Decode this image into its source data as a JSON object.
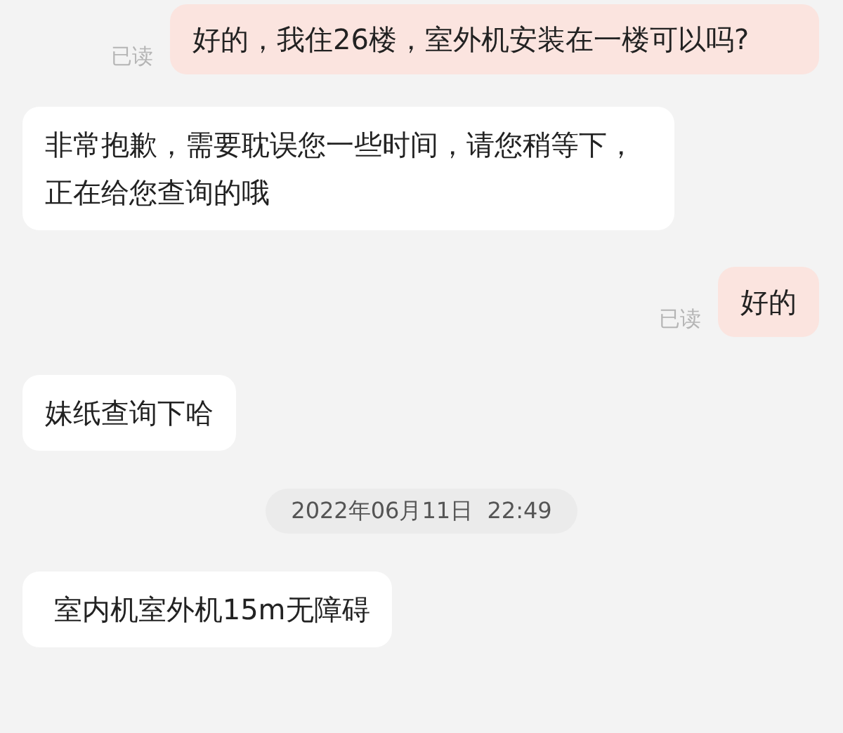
{
  "messages": [
    {
      "kind": "sent",
      "text": "好的，我住26楼，室外机安装在一楼可以吗?",
      "read_label": "已读"
    },
    {
      "kind": "received",
      "text": "非常抱歉，需要耽误您一些时间，请您稍等下，正在给您查询的哦"
    },
    {
      "kind": "sent",
      "text": "好的",
      "read_label": "已读"
    },
    {
      "kind": "received",
      "text": "妹纸查询下哈"
    },
    {
      "kind": "time",
      "text": "2022年06月11日  22:49"
    },
    {
      "kind": "received",
      "text": " 室内机室外机15m无障碍"
    }
  ]
}
